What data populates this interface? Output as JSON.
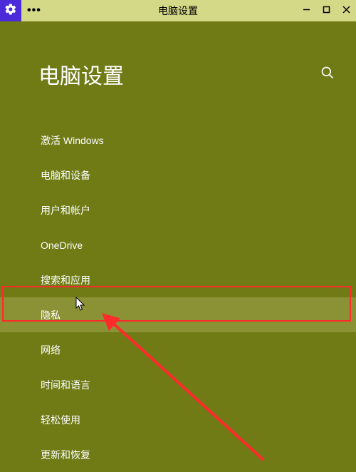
{
  "titlebar": {
    "title": "电脑设置",
    "dots": "•••"
  },
  "header": {
    "page_title": "电脑设置"
  },
  "nav": {
    "items": [
      {
        "label": "激活 Windows"
      },
      {
        "label": "电脑和设备"
      },
      {
        "label": "用户和帐户"
      },
      {
        "label": "OneDrive"
      },
      {
        "label": "搜索和应用"
      },
      {
        "label": "隐私"
      },
      {
        "label": "网络"
      },
      {
        "label": "时间和语言"
      },
      {
        "label": "轻松使用"
      },
      {
        "label": "更新和恢复"
      }
    ]
  }
}
